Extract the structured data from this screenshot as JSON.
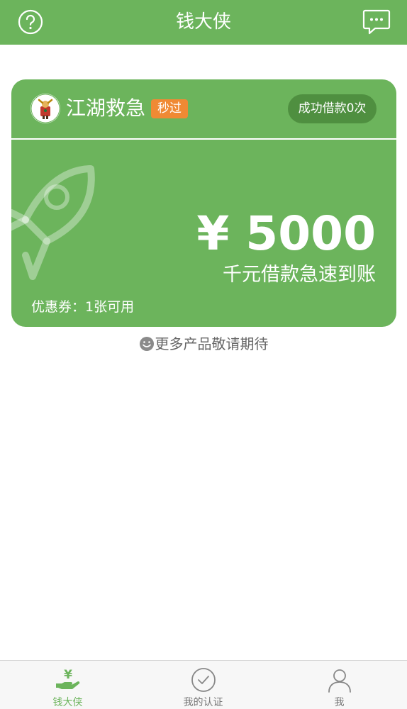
{
  "header": {
    "title": "钱大侠",
    "help_icon": "question-circle-icon",
    "message_icon": "chat-bubble-icon"
  },
  "card": {
    "product_name": "江湖救急",
    "badge": "秒过",
    "success_count": "成功借款0次",
    "amount": "¥ 5000",
    "amount_desc": "千元借款急速到账",
    "coupon": "优惠券：1张可用"
  },
  "more_products": "更多产品敬请期待",
  "tabbar": {
    "items": [
      {
        "label": "钱大侠",
        "icon": "money-hand-icon",
        "active": true
      },
      {
        "label": "我的认证",
        "icon": "check-circle-icon",
        "active": false
      },
      {
        "label": "我",
        "icon": "user-icon",
        "active": false
      }
    ]
  },
  "colors": {
    "primary": "#6cb45c",
    "badge": "#f08a34",
    "pill": "#4f8f40"
  }
}
